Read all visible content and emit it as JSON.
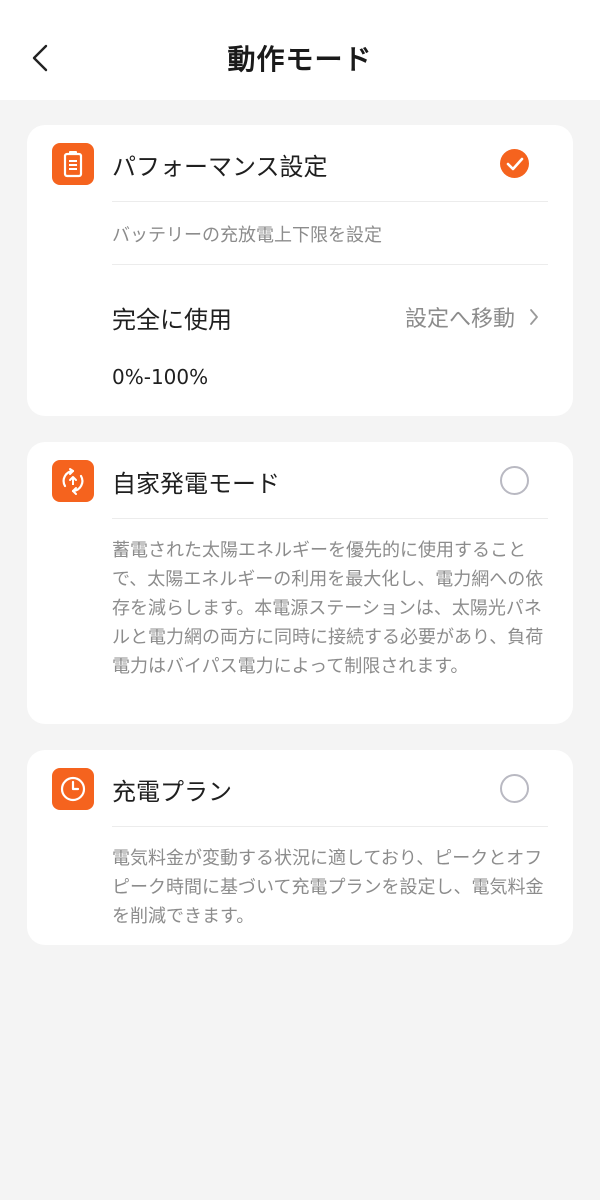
{
  "header": {
    "title": "動作モード",
    "back_icon": "chevron-left-icon"
  },
  "colors": {
    "accent": "#f5631e",
    "background": "#f4f4f4",
    "card": "#ffffff",
    "secondary_text": "#8c8c8c"
  },
  "modes": [
    {
      "title": "パフォーマンス設定",
      "icon": "battery-icon",
      "selected": true,
      "description": "バッテリーの充放電上下限を設定",
      "setting_label": "完全に使用",
      "setting_link": "設定へ移動",
      "range": "0%-100%"
    },
    {
      "title": "自家発電モード",
      "icon": "solar-cycle-icon",
      "selected": false,
      "description": "蓄電された太陽エネルギーを優先的に使用することで、太陽エネルギーの利用を最大化し、電力網への依存を減らします。本電源ステーションは、太陽光パネルと電力網の両方に同時に接続する必要があり、負荷電力はバイパス電力によって制限されます。"
    },
    {
      "title": "充電プラン",
      "icon": "clock-icon",
      "selected": false,
      "description": "電気料金が変動する状況に適しており、ピークとオフピーク時間に基づいて充電プランを設定し、電気料金を削減できます。"
    }
  ]
}
